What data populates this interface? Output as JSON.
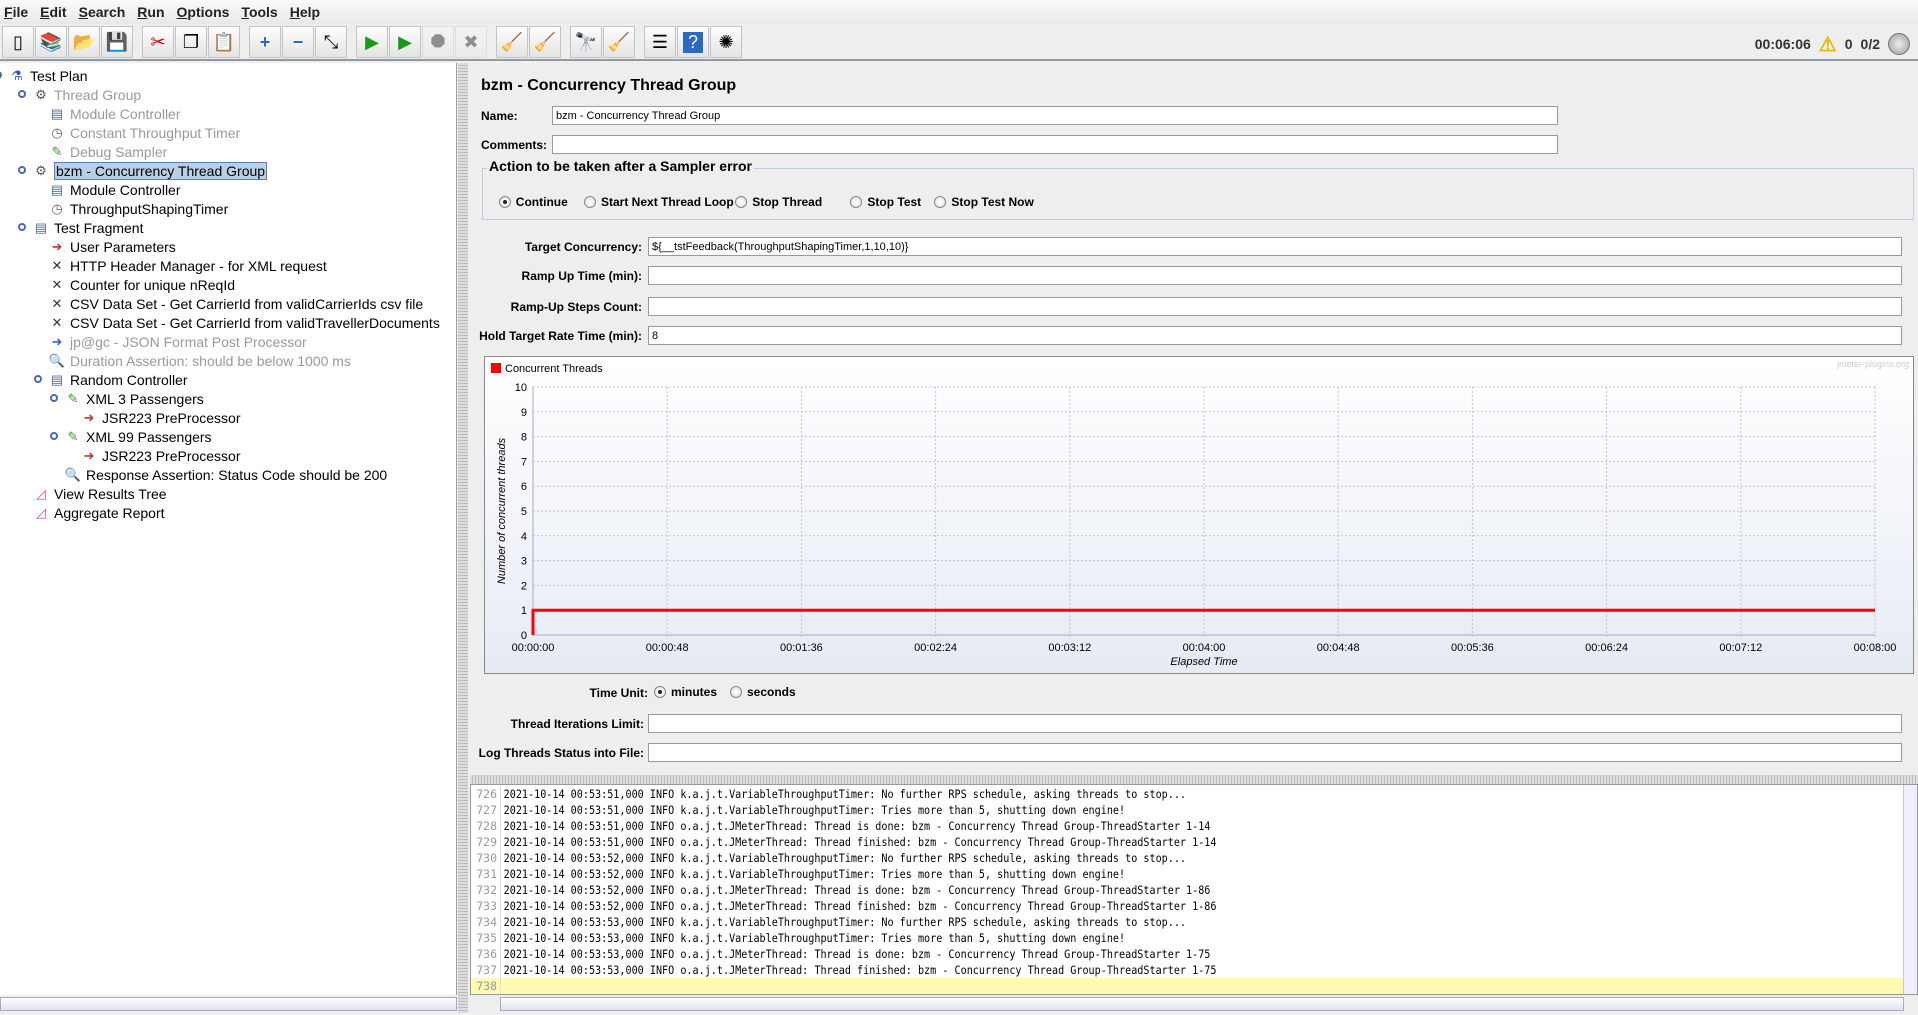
{
  "menu": [
    "File",
    "Edit",
    "Search",
    "Run",
    "Options",
    "Tools",
    "Help"
  ],
  "toolbar": [
    {
      "icon": "new-icon"
    },
    {
      "icon": "templates-icon"
    },
    {
      "icon": "open-icon"
    },
    {
      "icon": "save-icon"
    },
    {
      "sep": true
    },
    {
      "icon": "cut-icon"
    },
    {
      "icon": "copy-icon"
    },
    {
      "icon": "paste-icon"
    },
    {
      "sep": true
    },
    {
      "icon": "expand-icon"
    },
    {
      "icon": "collapse-icon"
    },
    {
      "icon": "toggle-icon"
    },
    {
      "sep": true
    },
    {
      "icon": "start-icon"
    },
    {
      "icon": "start-no-pauses-icon"
    },
    {
      "icon": "stop-icon",
      "disabled": true
    },
    {
      "icon": "shutdown-icon",
      "disabled": true
    },
    {
      "sep": true
    },
    {
      "icon": "clear-icon"
    },
    {
      "icon": "clear-all-icon"
    },
    {
      "sep": true
    },
    {
      "icon": "search-binoculars-icon"
    },
    {
      "icon": "reset-search-broom-icon"
    },
    {
      "sep": true
    },
    {
      "icon": "function-helper-icon"
    },
    {
      "icon": "help-icon"
    },
    {
      "icon": "remote-icon"
    }
  ],
  "status": {
    "elapsed": "00:06:06",
    "warnings": "0",
    "threads": "0/2"
  },
  "tree": [
    {
      "label": "Test Plan",
      "level": 0,
      "icon": "test-plan-icon",
      "handle": true
    },
    {
      "label": "Thread Group",
      "level": 1,
      "icon": "gear-icon",
      "handle": true,
      "disabled": true
    },
    {
      "label": "Module Controller",
      "level": 2,
      "icon": "controller-icon",
      "disabled": true
    },
    {
      "label": "Constant Throughput Timer",
      "level": 2,
      "icon": "timer-icon",
      "disabled": true
    },
    {
      "label": "Debug Sampler",
      "level": 2,
      "icon": "sampler-icon",
      "disabled": true
    },
    {
      "label": "bzm - Concurrency Thread Group",
      "level": 1,
      "icon": "gear-icon",
      "handle": true,
      "selected": true
    },
    {
      "label": "Module Controller",
      "level": 2,
      "icon": "controller-icon"
    },
    {
      "label": "ThroughputShapingTimer",
      "level": 2,
      "icon": "timer-icon"
    },
    {
      "label": "Test Fragment",
      "level": 1,
      "icon": "controller-icon",
      "handle": true
    },
    {
      "label": "User Parameters",
      "level": 2,
      "icon": "preprocessor-icon"
    },
    {
      "label": "HTTP Header Manager - for XML request",
      "level": 2,
      "icon": "config-icon"
    },
    {
      "label": "Counter for unique nReqId",
      "level": 2,
      "icon": "config-icon"
    },
    {
      "label": "CSV Data Set - Get CarrierId from validCarrierIds csv file",
      "level": 2,
      "icon": "config-icon"
    },
    {
      "label": "CSV Data Set - Get CarrierId from validTravellerDocuments",
      "level": 2,
      "icon": "config-icon"
    },
    {
      "label": "jp@gc - JSON Format Post Processor",
      "level": 2,
      "icon": "postprocessor-icon",
      "disabled": true
    },
    {
      "label": "Duration Assertion: should be below 1000 ms",
      "level": 2,
      "icon": "assertion-icon",
      "disabled": true
    },
    {
      "label": "Random Controller",
      "level": 2,
      "icon": "controller-icon",
      "handle": true
    },
    {
      "label": "XML 3 Passengers",
      "level": 3,
      "icon": "sampler-icon",
      "handle": true
    },
    {
      "label": "JSR223 PreProcessor",
      "level": 4,
      "icon": "preprocessor-icon"
    },
    {
      "label": "XML 99 Passengers",
      "level": 3,
      "icon": "sampler-icon",
      "handle": true
    },
    {
      "label": "JSR223 PreProcessor",
      "level": 4,
      "icon": "preprocessor-icon"
    },
    {
      "label": "Response Assertion: Status Code should be 200",
      "level": 3,
      "icon": "assertion-icon"
    },
    {
      "label": "View Results Tree",
      "level": 1,
      "icon": "listener-icon"
    },
    {
      "label": "Aggregate Report",
      "level": 1,
      "icon": "listener-icon"
    }
  ],
  "panel": {
    "title": "bzm - Concurrency Thread Group",
    "name_label": "Name:",
    "name_value": "bzm - Concurrency Thread Group",
    "comments_label": "Comments:",
    "comments_value": "",
    "error_action": {
      "legend": "Action to be taken after a Sampler error",
      "options": [
        "Continue",
        "Start Next Thread Loop",
        "Stop Thread",
        "Stop Test",
        "Stop Test Now"
      ],
      "selected": "Continue"
    },
    "fields": [
      {
        "label": "Target Concurrency:",
        "value": "${__tstFeedback(ThroughputShapingTimer,1,10,10)}"
      },
      {
        "label": "Ramp Up Time (min):",
        "value": ""
      },
      {
        "label": "Ramp-Up Steps Count:",
        "value": ""
      },
      {
        "label": "Hold Target Rate Time (min):",
        "value": "8"
      }
    ],
    "time_unit": {
      "label": "Time Unit:",
      "options": [
        "minutes",
        "seconds"
      ],
      "selected": "minutes"
    },
    "iterations_label": "Thread Iterations Limit:",
    "iterations_value": "",
    "log_label": "Log Threads Status into File:",
    "log_value": ""
  },
  "chart_data": {
    "type": "line",
    "watermark": "jmeter-plugins.org",
    "xlabel": "Elapsed Time",
    "ylabel": "Number of concurrent threads",
    "ylim": [
      0,
      10
    ],
    "yticks": [
      "0",
      "1",
      "2",
      "3",
      "4",
      "5",
      "6",
      "7",
      "8",
      "9",
      "10"
    ],
    "xlim_seconds": [
      0,
      480
    ],
    "xticks": [
      "00:00:00",
      "00:00:48",
      "00:01:36",
      "00:02:24",
      "00:03:12",
      "00:04:00",
      "00:04:48",
      "00:05:36",
      "00:06:24",
      "00:07:12",
      "00:08:00"
    ],
    "grid": true,
    "legend_placement": "top-left",
    "series": [
      {
        "name": "Concurrent Threads",
        "color": "#ff0000",
        "x": [
          "00:00:00",
          "00:00:00",
          "00:08:00"
        ],
        "y": [
          0,
          1,
          1
        ]
      }
    ]
  },
  "log": [
    {
      "n": "726",
      "t": "2021-10-14 00:53:51,000 INFO k.a.j.t.VariableThroughputTimer: No further RPS schedule, asking threads to stop..."
    },
    {
      "n": "727",
      "t": "2021-10-14 00:53:51,000 INFO k.a.j.t.VariableThroughputTimer: Tries more than 5, shutting down engine!"
    },
    {
      "n": "728",
      "t": "2021-10-14 00:53:51,000 INFO o.a.j.t.JMeterThread: Thread is done: bzm - Concurrency Thread Group-ThreadStarter 1-14"
    },
    {
      "n": "729",
      "t": "2021-10-14 00:53:51,000 INFO o.a.j.t.JMeterThread: Thread finished: bzm - Concurrency Thread Group-ThreadStarter 1-14"
    },
    {
      "n": "730",
      "t": "2021-10-14 00:53:52,000 INFO k.a.j.t.VariableThroughputTimer: No further RPS schedule, asking threads to stop..."
    },
    {
      "n": "731",
      "t": "2021-10-14 00:53:52,000 INFO k.a.j.t.VariableThroughputTimer: Tries more than 5, shutting down engine!"
    },
    {
      "n": "732",
      "t": "2021-10-14 00:53:52,000 INFO o.a.j.t.JMeterThread: Thread is done: bzm - Concurrency Thread Group-ThreadStarter 1-86"
    },
    {
      "n": "733",
      "t": "2021-10-14 00:53:52,000 INFO o.a.j.t.JMeterThread: Thread finished: bzm - Concurrency Thread Group-ThreadStarter 1-86"
    },
    {
      "n": "734",
      "t": "2021-10-14 00:53:53,000 INFO k.a.j.t.VariableThroughputTimer: No further RPS schedule, asking threads to stop..."
    },
    {
      "n": "735",
      "t": "2021-10-14 00:53:53,000 INFO k.a.j.t.VariableThroughputTimer: Tries more than 5, shutting down engine!"
    },
    {
      "n": "736",
      "t": "2021-10-14 00:53:53,000 INFO o.a.j.t.JMeterThread: Thread is done: bzm - Concurrency Thread Group-ThreadStarter 1-75"
    },
    {
      "n": "737",
      "t": "2021-10-14 00:53:53,000 INFO o.a.j.t.JMeterThread: Thread finished: bzm - Concurrency Thread Group-ThreadStarter 1-75"
    },
    {
      "n": "738",
      "t": ""
    }
  ]
}
